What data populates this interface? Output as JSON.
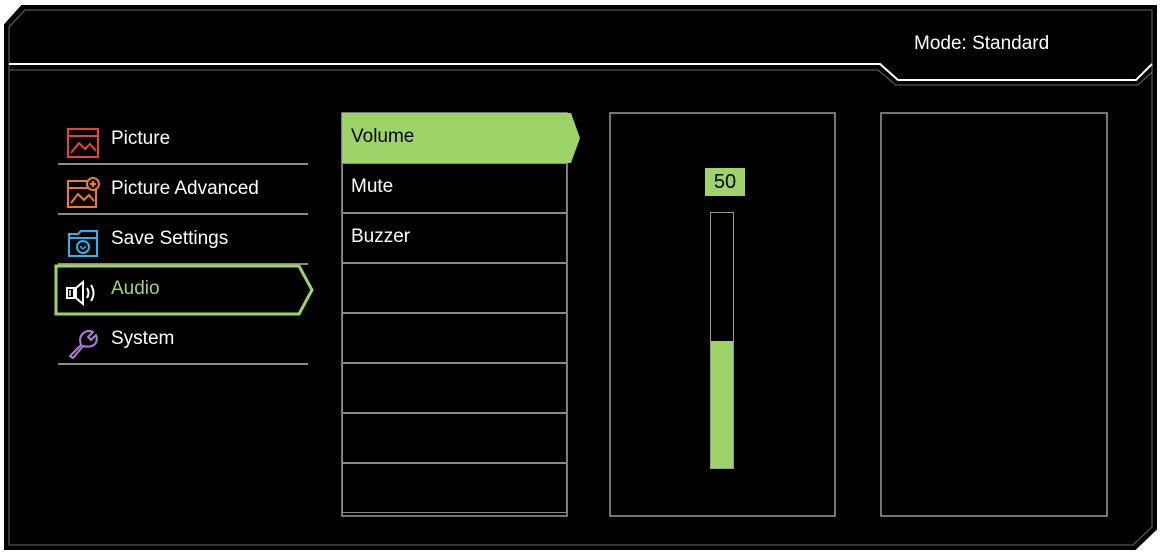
{
  "header": {
    "mode_text": "Mode: Standard"
  },
  "main_menu": {
    "items": [
      {
        "label": "Picture",
        "icon": "picture-icon",
        "active": false
      },
      {
        "label": "Picture Advanced",
        "icon": "picture-advanced-icon",
        "active": false
      },
      {
        "label": "Save Settings",
        "icon": "save-settings-icon",
        "active": false
      },
      {
        "label": "Audio",
        "icon": "audio-speaker-icon",
        "active": true
      },
      {
        "label": "System",
        "icon": "system-wrench-icon",
        "active": false
      }
    ]
  },
  "sub_menu": {
    "items": [
      {
        "label": "Volume",
        "selected": true
      },
      {
        "label": "Mute",
        "selected": false
      },
      {
        "label": "Buzzer",
        "selected": false
      },
      {
        "label": ""
      },
      {
        "label": ""
      },
      {
        "label": ""
      },
      {
        "label": ""
      },
      {
        "label": ""
      }
    ]
  },
  "volume": {
    "value_text": "50",
    "level_fraction": 0.5
  },
  "colors": {
    "background": "#000000",
    "accent_green": "#9ed36a",
    "divider_gray": "#8a8a8a",
    "picture_icon_red": "#e8423a",
    "picture_advanced_icon_orange": "#f07a2a",
    "save_icon_cyan": "#2ab4e8",
    "system_icon_purple": "#b27ad8"
  }
}
